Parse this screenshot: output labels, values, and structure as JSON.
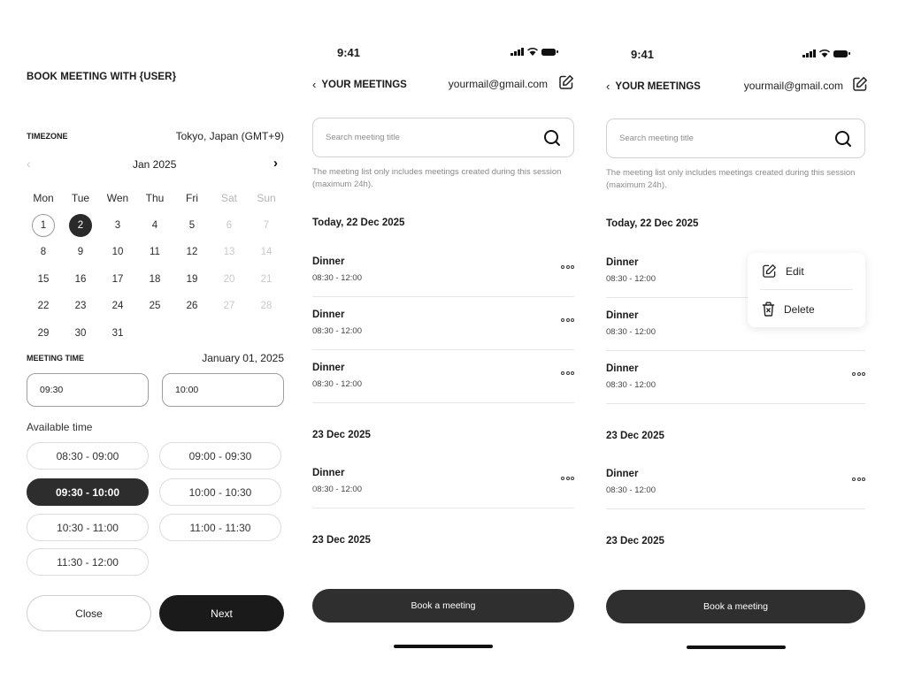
{
  "booking": {
    "title": "BOOK MEETING WITH {USER}",
    "timezone_label": "TIMEZONE",
    "timezone_value": "Tokyo, Japan (GMT+9)",
    "calendar": {
      "prev_icon": "chevron-left-icon",
      "next_icon": "chevron-right-icon",
      "month": "Jan 2025",
      "weekdays": [
        "Mon",
        "Tue",
        "Wen",
        "Thu",
        "Fri",
        "Sat",
        "Sun"
      ],
      "weeks": [
        [
          "1",
          "2",
          "3",
          "4",
          "5",
          "6",
          "7"
        ],
        [
          "8",
          "9",
          "10",
          "11",
          "12",
          "13",
          "14"
        ],
        [
          "15",
          "16",
          "17",
          "18",
          "19",
          "20",
          "21"
        ],
        [
          "22",
          "23",
          "24",
          "25",
          "26",
          "27",
          "28"
        ],
        [
          "29",
          "30",
          "31",
          "",
          "",
          "",
          ""
        ]
      ],
      "today": "1",
      "selected": "2"
    },
    "meeting_time_label": "MEETING TIME",
    "meeting_time_date": "January 01, 2025",
    "start_time": "09:30",
    "end_time": "10:00",
    "available_label": "Available time",
    "slots": [
      "08:30 - 09:00",
      "09:00 - 09:30",
      "09:30 - 10:00",
      "10:00 - 10:30",
      "10:30 - 11:00",
      "11:00 - 11:30",
      "11:30 - 12:00"
    ],
    "selected_slot": "09:30 - 10:00",
    "close_label": "Close",
    "next_label": "Next"
  },
  "meetings_screen": {
    "status_time": "9:41",
    "back_label": "YOUR MEETINGS",
    "email": "yourmail@gmail.com",
    "search_placeholder": "Search meeting title",
    "note": "The meeting list only includes meetings created during this session (maximum 24h).",
    "sections": [
      {
        "heading": "Today, 22 Dec 2025",
        "meetings": [
          {
            "title": "Dinner",
            "time": "08:30 - 12:00"
          },
          {
            "title": "Dinner",
            "time": "08:30 - 12:00"
          },
          {
            "title": "Dinner",
            "time": "08:30 - 12:00"
          }
        ]
      },
      {
        "heading": "23 Dec 2025",
        "meetings": [
          {
            "title": "Dinner",
            "time": "08:30 - 12:00"
          }
        ]
      },
      {
        "heading": "23 Dec 2025",
        "meetings": []
      }
    ],
    "book_label": "Book a meeting",
    "menu": {
      "edit_label": "Edit",
      "delete_label": "Delete"
    }
  },
  "colors": {
    "dark": "#2d2d2d",
    "text": "#1b1b1b",
    "muted": "#8a8a8a",
    "border": "#d3d3d3"
  }
}
